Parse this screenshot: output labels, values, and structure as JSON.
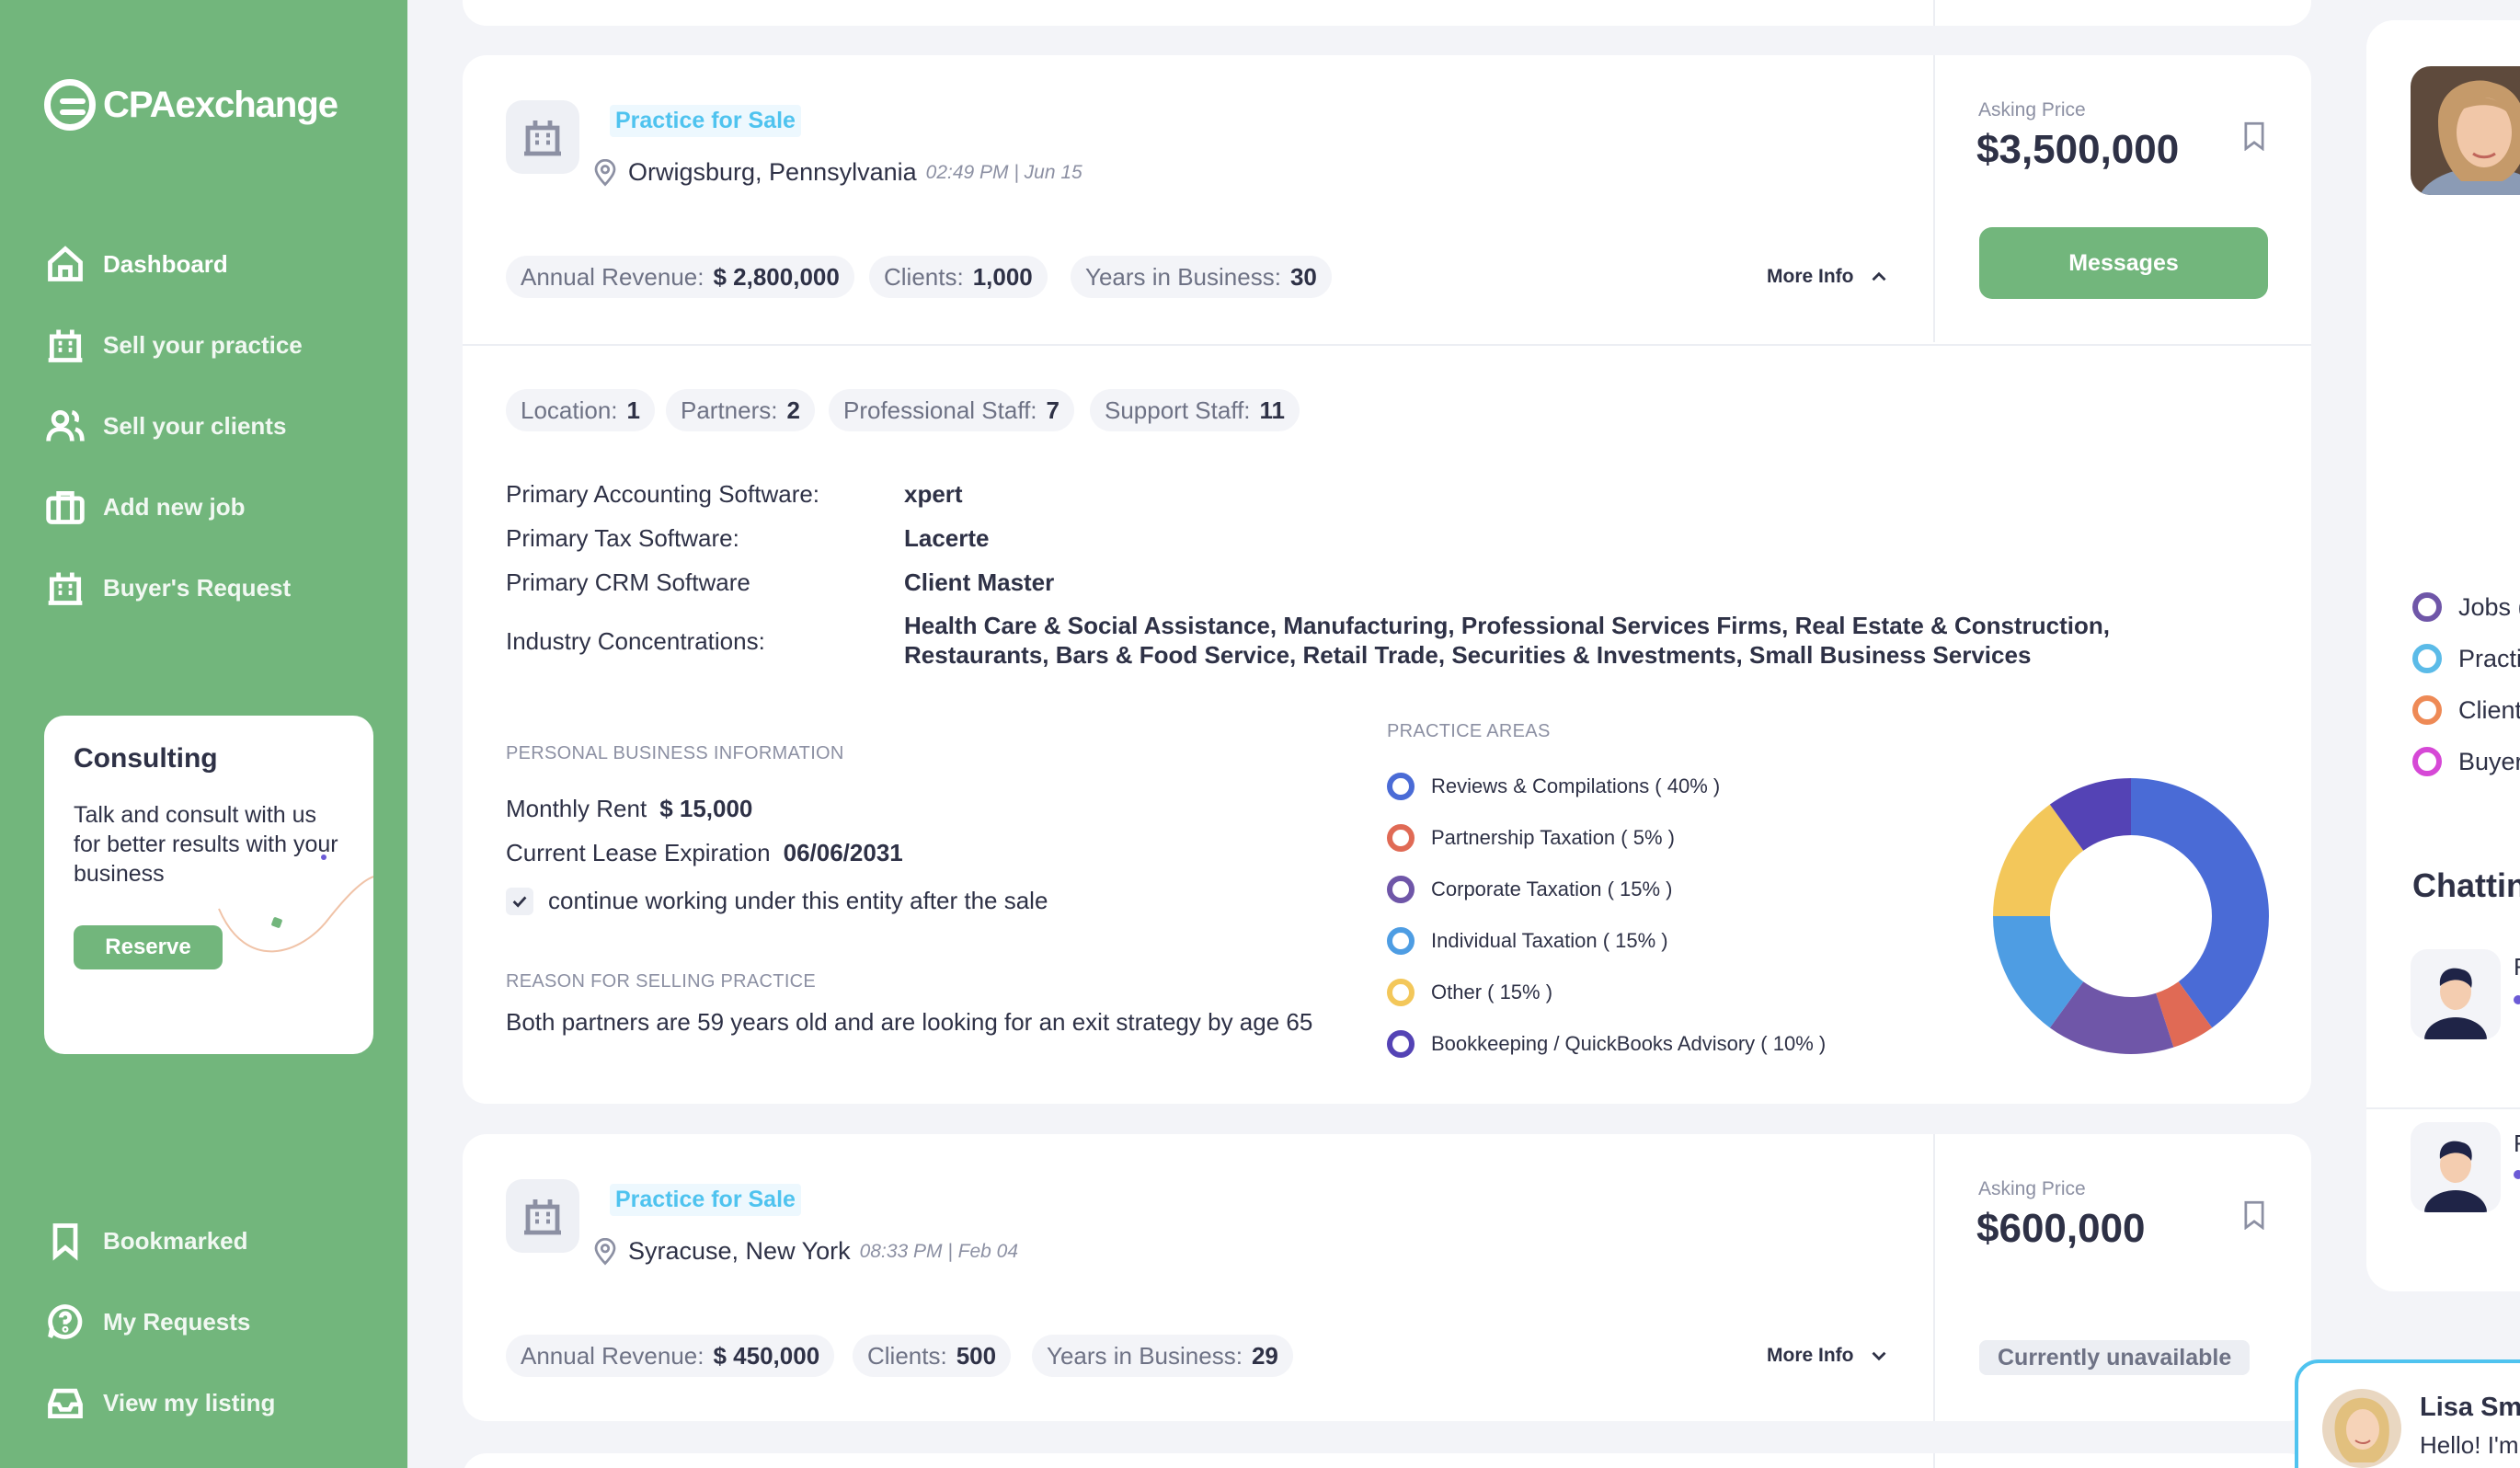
{
  "brand": {
    "name": "CPAexchange"
  },
  "sidebar": {
    "items": [
      {
        "label": "Dashboard",
        "icon": "home-icon"
      },
      {
        "label": "Sell your practice",
        "icon": "building-icon"
      },
      {
        "label": "Sell your clients",
        "icon": "users-icon"
      },
      {
        "label": "Add new job",
        "icon": "briefcase-icon"
      },
      {
        "label": "Buyer's Request",
        "icon": "building-icon"
      }
    ],
    "bottom_items": [
      {
        "label": "Bookmarked",
        "icon": "bookmark-icon"
      },
      {
        "label": "My Requests",
        "icon": "help-bubble-icon"
      },
      {
        "label": "View my listing",
        "icon": "inbox-icon"
      }
    ],
    "consulting": {
      "title": "Consulting",
      "text": "Talk and consult with us for better results with your business",
      "button": "Reserve"
    }
  },
  "listings": [
    {
      "tag": "Practice for Sale",
      "location": "Orwigsburg, Pennsylvania",
      "timestamp": "02:49 PM | Jun 15",
      "stats": [
        {
          "label": "Annual Revenue:",
          "value": "$ 2,800,000"
        },
        {
          "label": "Clients:",
          "value": "1,000"
        },
        {
          "label": "Years in Business:",
          "value": "30"
        }
      ],
      "more_info": "More Info",
      "asking_label": "Asking Price",
      "asking_price": "$3,500,000",
      "action": "Messages",
      "details": {
        "counts": [
          {
            "label": "Location:",
            "value": "1"
          },
          {
            "label": "Partners:",
            "value": "2"
          },
          {
            "label": "Professional Staff:",
            "value": "7"
          },
          {
            "label": "Support Staff:",
            "value": "11"
          }
        ],
        "software": [
          {
            "label": "Primary Accounting Software:",
            "value": "xpert"
          },
          {
            "label": "Primary Tax Software:",
            "value": "Lacerte"
          },
          {
            "label": "Primary CRM Software",
            "value": "Client Master"
          }
        ],
        "industry_label": "Industry Concentrations:",
        "industry_value": "Health Care & Social Assistance, Manufacturing, Professional Services Firms, Real Estate & Construction, Restaurants, Bars & Food Service, Retail Trade, Securities & Investments, Small Business Services",
        "personal_title": "PERSONAL BUSINESS INFORMATION",
        "monthly_rent_label": "Monthly Rent",
        "monthly_rent_value": "$ 15,000",
        "lease_label": "Current Lease Expiration",
        "lease_value": "06/06/2031",
        "checkbox_label": "continue working under this entity after the sale",
        "checkbox_checked": true,
        "reason_title": "REASON FOR SELLING PRACTICE",
        "reason_text": "Both partners are 59 years old and are looking for an exit strategy by age 65",
        "practice_areas_title": "PRACTICE AREAS"
      }
    },
    {
      "tag": "Practice for Sale",
      "location": "Syracuse, New York",
      "timestamp": "08:33 PM | Feb 04",
      "stats": [
        {
          "label": "Annual Revenue:",
          "value": "$ 450,000"
        },
        {
          "label": "Clients:",
          "value": "500"
        },
        {
          "label": "Years in Business:",
          "value": "29"
        }
      ],
      "more_info": "More Info",
      "asking_label": "Asking Price",
      "asking_price": "$600,000",
      "status": "Currently unavailable"
    }
  ],
  "chart_data": {
    "type": "pie",
    "donut": true,
    "legend_placement": "left",
    "categories": [
      "Reviews & Compilations ( 40% )",
      "Partnership Taxation ( 5% )",
      "Corporate Taxation ( 15% )",
      "Individual Taxation ( 15% )",
      "Other ( 15% )",
      "Bookkeeping / QuickBooks Advisory ( 10% )"
    ],
    "values": [
      40,
      5,
      15,
      15,
      15,
      10
    ],
    "colors": [
      "#4a6bd6",
      "#e06a55",
      "#6f56a8",
      "#4e9de3",
      "#f3c75a",
      "#5443b5"
    ]
  },
  "right_panel": {
    "legend": [
      {
        "label": "Jobs (",
        "color": "#6f56a8"
      },
      {
        "label": "Practi",
        "color": "#5bbbe8"
      },
      {
        "label": "Client",
        "color": "#ee8a56"
      },
      {
        "label": "Buyer'",
        "color": "#d648d6"
      }
    ],
    "chat_title": "Chattin",
    "chat_rows": [
      {
        "name_stub": "F"
      },
      {
        "name_stub": "F"
      }
    ]
  },
  "chat_popup": {
    "name": "Lisa Smi",
    "message": "Hello! I'm"
  }
}
